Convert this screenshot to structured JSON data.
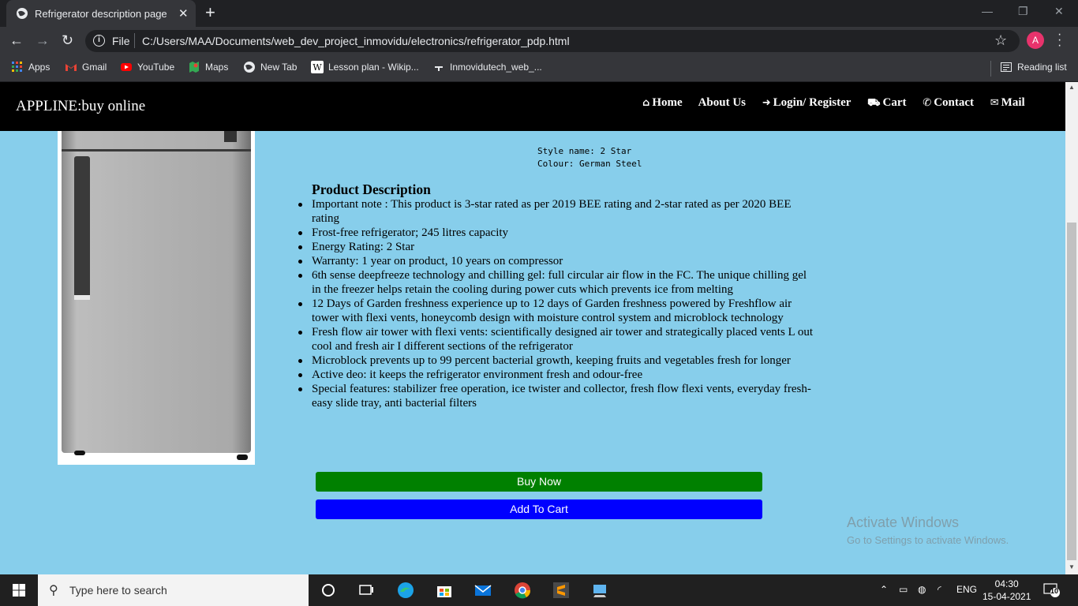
{
  "browser": {
    "tab_title": "Refrigerator description page",
    "new_tab_symbol": "+",
    "close_symbol": "✕",
    "file_label": "File",
    "url": "C:/Users/MAA/Documents/web_dev_project_inmovidu/electronics/refrigerator_pdp.html",
    "profile_initial": "A",
    "bookmarks": [
      {
        "label": "Apps",
        "icon": "apps-grid-icon"
      },
      {
        "label": "Gmail",
        "icon": "gmail-icon"
      },
      {
        "label": "YouTube",
        "icon": "youtube-icon"
      },
      {
        "label": "Maps",
        "icon": "maps-icon"
      },
      {
        "label": "New Tab",
        "icon": "globe-icon"
      },
      {
        "label": "Lesson plan - Wikip...",
        "icon": "wikipedia-icon"
      },
      {
        "label": "Inmovidutech_web_...",
        "icon": "bookmark-icon"
      }
    ],
    "reading_list": "Reading list"
  },
  "site": {
    "brand": "APPLINE:buy online",
    "nav": [
      {
        "label": "Home",
        "icon": "home-icon",
        "glyph": "⌂"
      },
      {
        "label": "About Us",
        "icon": "",
        "glyph": ""
      },
      {
        "label": "Login/ Register",
        "icon": "sign-in-icon",
        "glyph": "➜"
      },
      {
        "label": "Cart",
        "icon": "cart-icon",
        "glyph": "🛒"
      },
      {
        "label": "Contact",
        "icon": "phone-icon",
        "glyph": "✆"
      },
      {
        "label": "Mail",
        "icon": "envelope-icon",
        "glyph": "✉"
      }
    ]
  },
  "product": {
    "specs": [
      "Style name: 2 Star",
      "Colour: German Steel"
    ],
    "description_title": "Product Description",
    "description_items": [
      "Important note : This product is 3-star rated as per 2019 BEE rating and 2-star rated as per 2020 BEE rating",
      "Frost-free refrigerator; 245 litres capacity",
      "Energy Rating: 2 Star",
      "Warranty: 1 year on product, 10 years on compressor",
      "6th sense deepfreeze technology and chilling gel: full circular air flow in the FC. The unique chilling gel in the freezer helps retain the cooling during power cuts which prevents ice from melting",
      "12 Days of Garden freshness experience up to 12 days of Garden freshness powered by Freshflow air tower with flexi vents, honeycomb design with moisture control system and microblock technology",
      "Fresh flow air tower with flexi vents: scientifically designed air tower and strategically placed vents L out cool and fresh air I different sections of the refrigerator",
      "Microblock prevents up to 99 percent bacterial growth, keeping fruits and vegetables fresh for longer",
      "Active deo: it keeps the refrigerator environment fresh and odour-free",
      "Special features: stabilizer free operation, ice twister and collector, fresh flow flexi vents, everyday fresh-easy slide tray, anti bacterial filters"
    ],
    "buy_now": "Buy Now",
    "add_to_cart": "Add To Cart",
    "buy_color": "#008000",
    "cart_color": "#0000ff"
  },
  "watermark": {
    "line1": "Activate Windows",
    "line2": "Go to Settings to activate Windows."
  },
  "taskbar": {
    "search_placeholder": "Type here to search",
    "language": "ENG",
    "time": "04:30",
    "date": "15-04-2021",
    "notification_count": "10"
  }
}
